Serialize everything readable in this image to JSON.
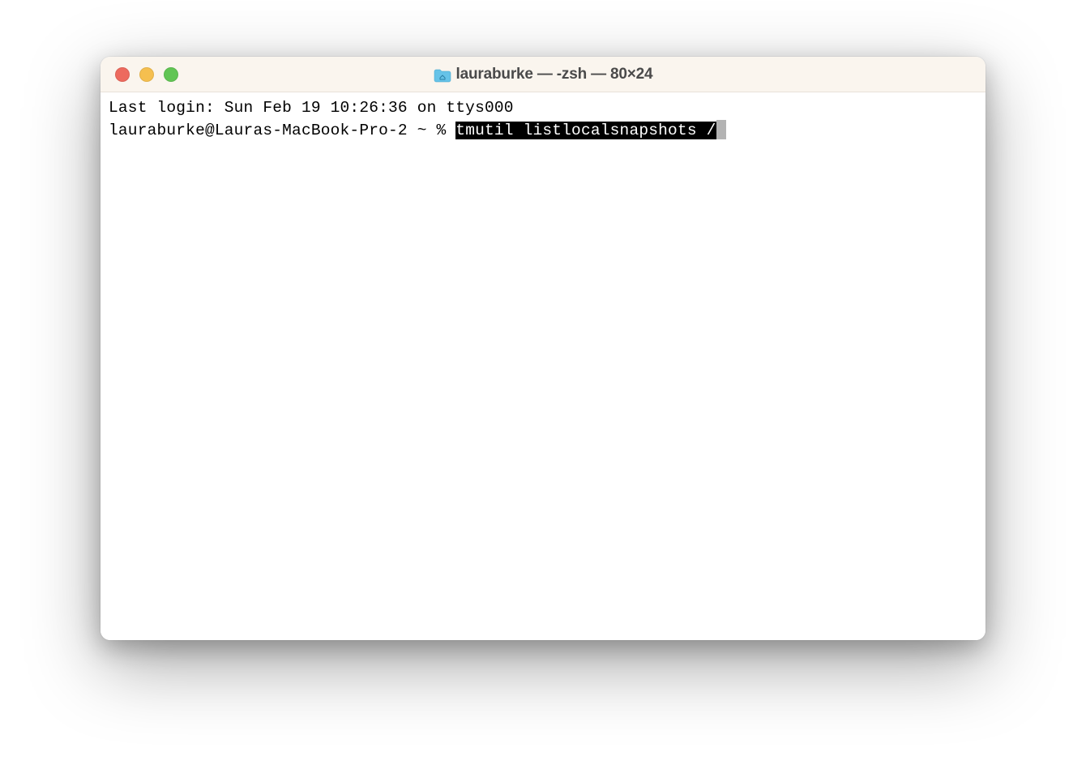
{
  "titlebar": {
    "title": "lauraburke — -zsh — 80×24",
    "traffic_lights": {
      "close": "close",
      "minimize": "minimize",
      "maximize": "maximize"
    }
  },
  "terminal": {
    "last_login_line": "Last login: Sun Feb 19 10:26:36 on ttys000",
    "prompt": "lauraburke@Lauras-MacBook-Pro-2 ~ % ",
    "command": "tmutil listlocalsnapshots /"
  }
}
